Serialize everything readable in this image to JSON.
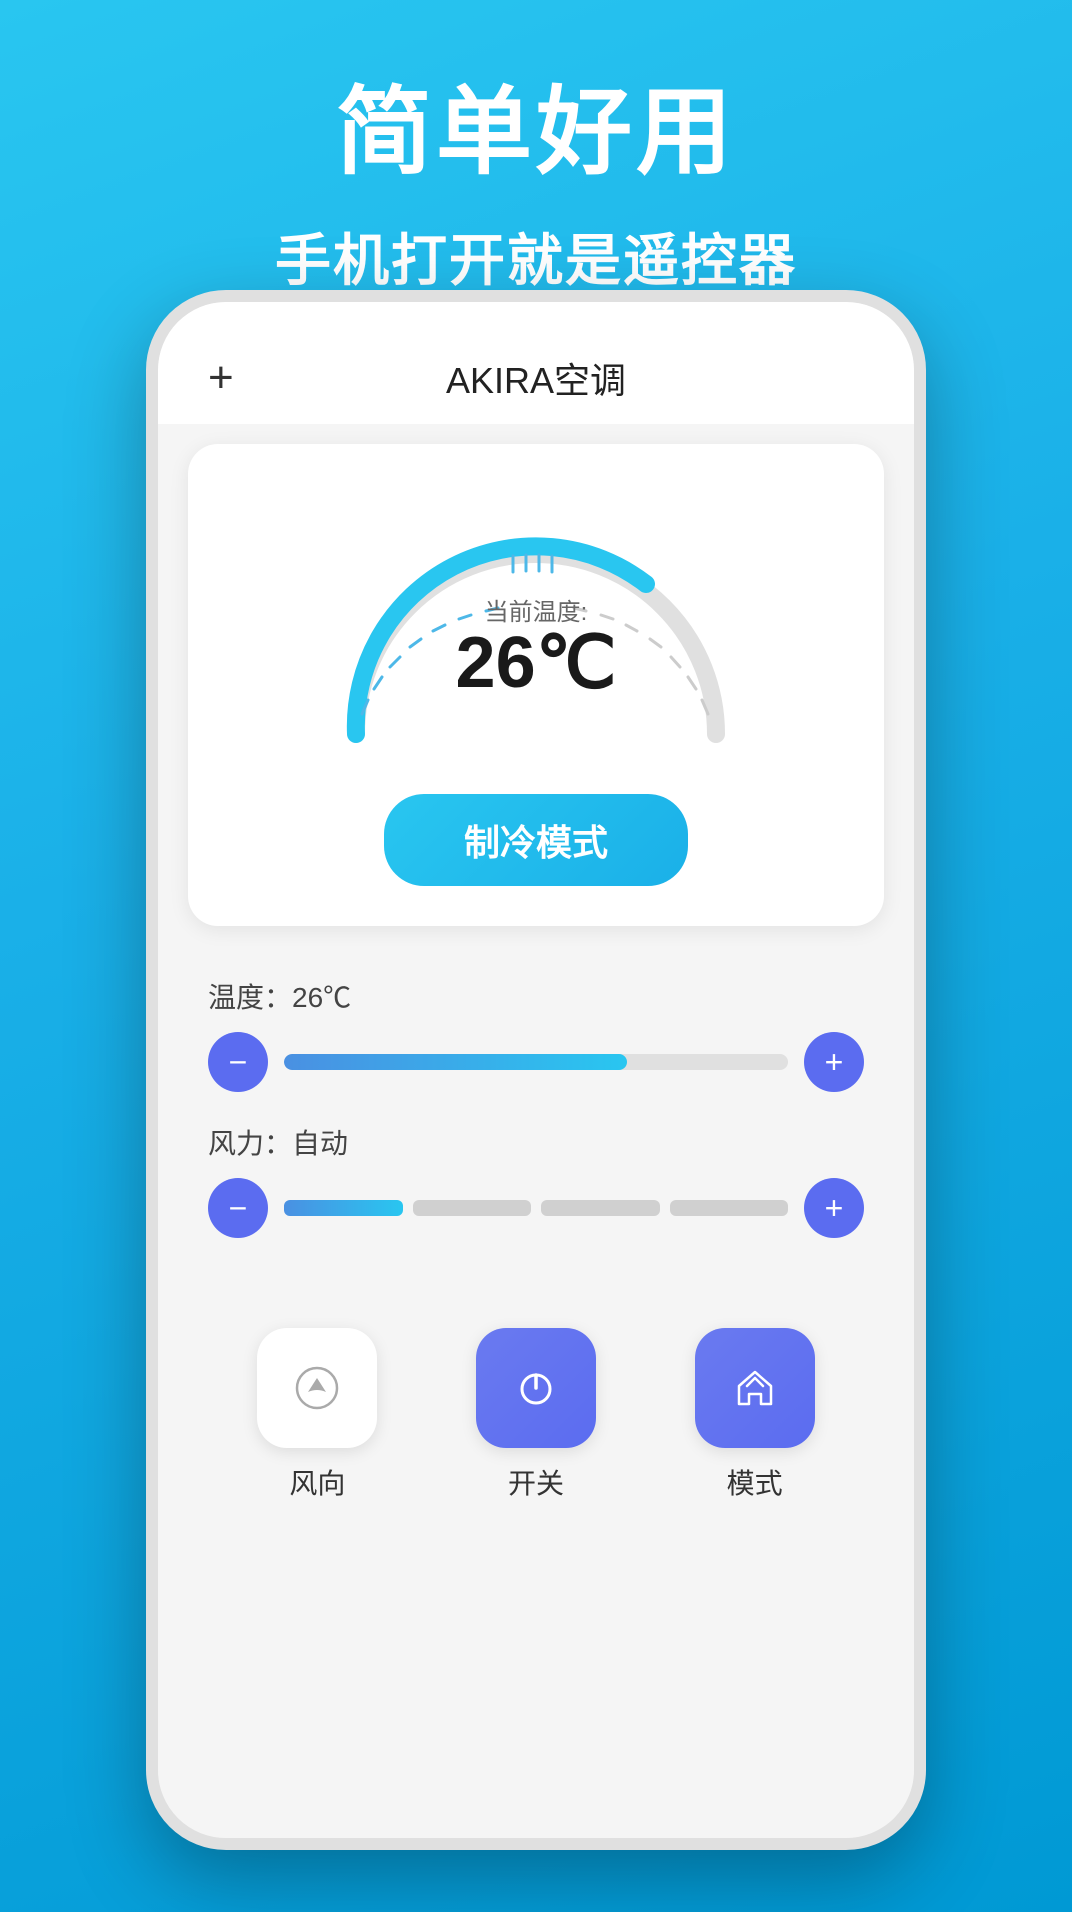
{
  "header": {
    "title_main": "简单好用",
    "title_sub": "手机打开就是遥控器"
  },
  "phone": {
    "nav": {
      "plus_symbol": "+",
      "title": "AKIRA空调"
    },
    "thermostat": {
      "temp_label": "当前温度:",
      "temp_value": "26℃",
      "mode_button_label": "制冷模式"
    },
    "temperature_control": {
      "label": "温度：26℃",
      "minus_label": "−",
      "plus_label": "+",
      "fill_percent": 68
    },
    "wind_control": {
      "label": "风力：自动",
      "minus_label": "−",
      "plus_label": "+",
      "active_segments": 1,
      "total_segments": 4
    },
    "bottom_buttons": [
      {
        "id": "wind-dir",
        "label": "风向",
        "active": false,
        "icon": "wind-direction"
      },
      {
        "id": "power",
        "label": "开关",
        "active": true,
        "icon": "power"
      },
      {
        "id": "mode",
        "label": "模式",
        "active": true,
        "icon": "home"
      }
    ]
  }
}
